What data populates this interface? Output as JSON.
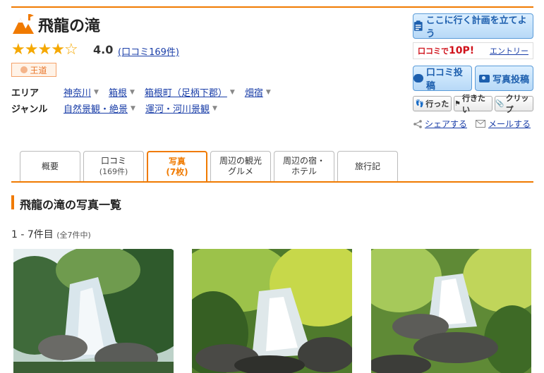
{
  "spot": {
    "title": "飛龍の滝",
    "rating": "4.0",
    "stars_filled": 4,
    "stars_total": 5,
    "review_link": "(口コミ169件)",
    "badge": "王道"
  },
  "meta": {
    "area_label": "エリア",
    "area_items": [
      "神奈川",
      "箱根",
      "箱根町（足柄下郡）",
      "畑宿"
    ],
    "genre_label": "ジャンル",
    "genre_items": [
      "自然景観・絶景",
      "運河・河川景観"
    ]
  },
  "actions": {
    "plan_label": "ここに行く計画を立てよう",
    "points_text": "口コミで",
    "points_value": "10P!",
    "entry_link": "エントリー",
    "review_post": "口コミ投稿",
    "photo_post": "写真投稿",
    "went": "行った",
    "want": "行きたい",
    "clip": "クリップ",
    "share": "シェアする",
    "mail": "メールする"
  },
  "tabs": [
    {
      "label": "概要",
      "sub": ""
    },
    {
      "label": "口コミ",
      "sub": "(169件)"
    },
    {
      "label": "写真",
      "sub": "(7枚)"
    },
    {
      "label": "周辺の観光",
      "sub": "グルメ"
    },
    {
      "label": "周辺の宿・",
      "sub": "ホテル"
    },
    {
      "label": "旅行記",
      "sub": ""
    }
  ],
  "active_tab": 2,
  "section": {
    "title": "飛龍の滝の写真一覧",
    "count": "1 - 7件目",
    "count_total": "(全7件中)"
  },
  "colors": {
    "accent": "#f07a00",
    "link": "#1a3ea8",
    "star": "#f5a800",
    "points": "#d0121b"
  },
  "icons": [
    "mountain-logo-icon",
    "star-icon",
    "medal-icon",
    "clipboard-icon",
    "speech-bubble-icon",
    "camera-icon",
    "footprint-icon",
    "flag-icon",
    "paperclip-icon",
    "share-icon",
    "mail-icon",
    "caret-down-icon"
  ]
}
